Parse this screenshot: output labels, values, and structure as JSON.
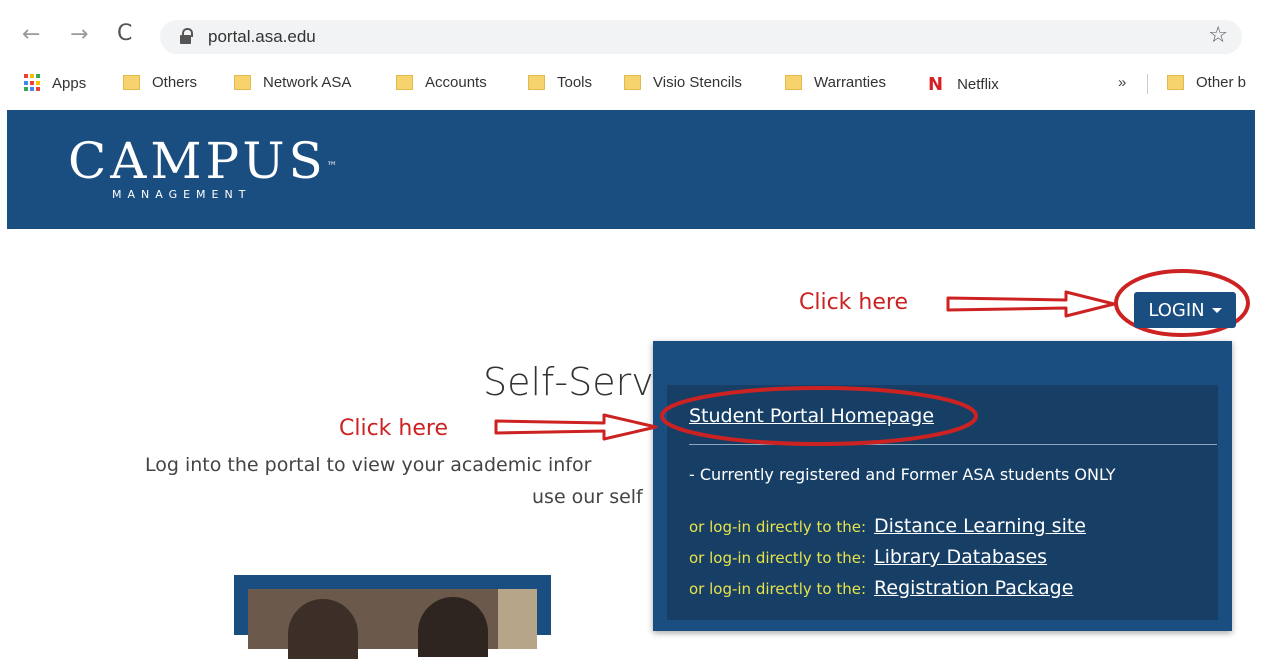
{
  "browser": {
    "url": "portal.asa.edu",
    "bookmarks": [
      {
        "label": "Apps",
        "icon": "apps-icon"
      },
      {
        "label": "Others",
        "icon": "folder-icon"
      },
      {
        "label": "Network ASA",
        "icon": "folder-icon"
      },
      {
        "label": "Accounts",
        "icon": "folder-icon"
      },
      {
        "label": "Tools",
        "icon": "folder-icon"
      },
      {
        "label": "Visio Stencils",
        "icon": "folder-icon"
      },
      {
        "label": "Warranties",
        "icon": "folder-icon"
      },
      {
        "label": "Netflix",
        "icon": "netflix-icon"
      }
    ],
    "overflow": "»",
    "other_bookmarks": "Other b"
  },
  "header": {
    "logo_main": "CAMPUS",
    "logo_tm": "™",
    "logo_sub": "MANAGEMENT",
    "color": "#1b4e80"
  },
  "page": {
    "heading": "Self-Serv",
    "desc_line1": "Log into the portal to view your academic infor",
    "desc_line2": "use our self"
  },
  "annotations": {
    "login": "Click here",
    "portal": "Click here",
    "color": "#cc2222"
  },
  "login": {
    "label": "LOGIN"
  },
  "dropdown": {
    "portal_link": "Student Portal Homepage",
    "note": "- Currently registered and Former ASA students ONLY",
    "prefix": "or log-in directly to the:",
    "links": [
      "Distance Learning site",
      "Library Databases",
      "Registration Package"
    ],
    "prefix_color": "#e7e34b"
  }
}
